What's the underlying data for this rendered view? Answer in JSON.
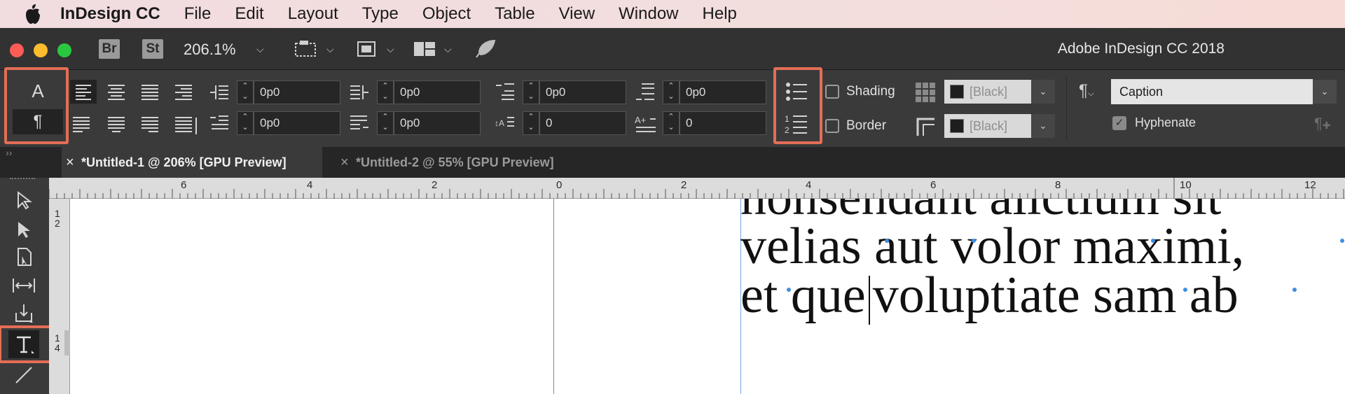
{
  "menubar": {
    "app_name": "InDesign CC",
    "items": [
      "File",
      "Edit",
      "Layout",
      "Type",
      "Object",
      "Table",
      "View",
      "Window",
      "Help"
    ]
  },
  "titlebar": {
    "bridge_label": "Br",
    "stock_label": "St",
    "zoom": "206.1%",
    "window_title": "Adobe InDesign CC 2018"
  },
  "control_panel": {
    "indent_fields": [
      "0p0",
      "0p0",
      "0p0",
      "0p0"
    ],
    "space_fields": [
      "0p0",
      "0p0",
      "0",
      "0"
    ],
    "shading_label": "Shading",
    "border_label": "Border",
    "shading_swatch": "[Black]",
    "border_swatch": "[Black]",
    "paragraph_style": "Caption",
    "hyphenate_label": "Hyphenate",
    "hyphenate_checked": true
  },
  "tabs": [
    {
      "label": "*Untitled-1 @ 206% [GPU Preview]",
      "active": true
    },
    {
      "label": "*Untitled-2 @ 55% [GPU Preview]",
      "active": false
    }
  ],
  "ruler": {
    "h_ticks": [
      "6",
      "4",
      "2",
      "0",
      "2",
      "4",
      "6",
      "8",
      "10",
      "12"
    ],
    "v_tick_top": [
      "1",
      "2"
    ],
    "v_tick_bottom": [
      "1",
      "4"
    ]
  },
  "document": {
    "line1": "nonsendant alictium sit",
    "line2": "velias aut volor maximi,",
    "line3a": "et que",
    "line3b": "voluptiate sam ab"
  },
  "colors": {
    "highlight": "#e36e56",
    "hidden_char_dot": "#3e8fe0"
  }
}
